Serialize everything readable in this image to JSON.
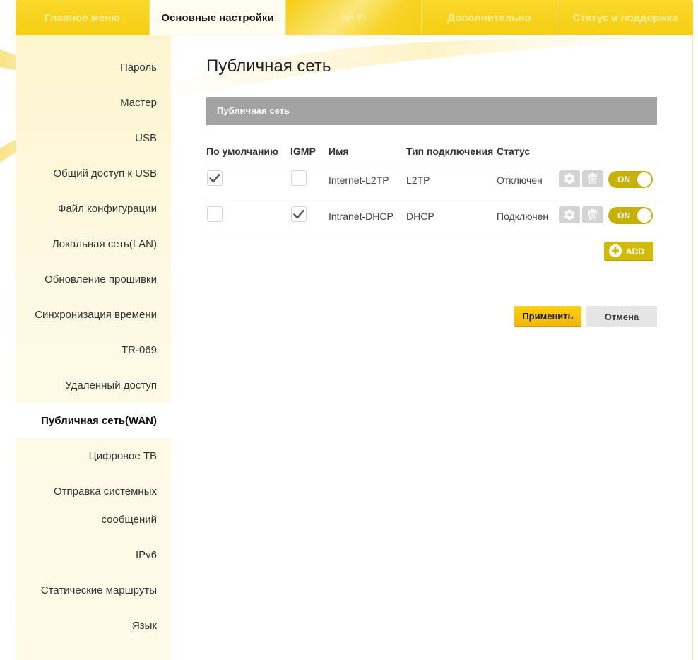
{
  "topnav": {
    "tabs": [
      {
        "label": "Главное меню",
        "active": false
      },
      {
        "label": "Основные настройки",
        "active": true
      },
      {
        "label": "Wi-Fi",
        "active": false
      },
      {
        "label": "Дополнительно",
        "active": false
      },
      {
        "label": "Статус и поддержка",
        "active": false
      }
    ]
  },
  "sidebar": {
    "items": [
      {
        "label": "Пароль"
      },
      {
        "label": "Мастер"
      },
      {
        "label": "USB"
      },
      {
        "label": "Общий доступ к USB"
      },
      {
        "label": "Файл конфигурации"
      },
      {
        "label": "Локальная сеть(LAN)"
      },
      {
        "label": "Обновление прошивки"
      },
      {
        "label": "Синхронизация времени"
      },
      {
        "label": "TR-069"
      },
      {
        "label": "Удаленный доступ"
      },
      {
        "label": "Публичная сеть(WAN)",
        "active": true
      },
      {
        "label": "Цифровое ТВ"
      },
      {
        "label": "Отправка системных"
      },
      {
        "label": "сообщений"
      },
      {
        "label": "IPv6"
      },
      {
        "label": "Статические маршруты"
      },
      {
        "label": "Язык"
      }
    ]
  },
  "main": {
    "title": "Публичная сеть",
    "section_title": "Публичная сеть",
    "table": {
      "headers": [
        "По умолчанию",
        "IGMP",
        "Имя",
        "Тип подключения",
        "Статус"
      ],
      "rows": [
        {
          "default": true,
          "igmp": false,
          "name": "Internet-L2TP",
          "type": "L2TP",
          "status": "Отключен",
          "toggle": "ON"
        },
        {
          "default": false,
          "igmp": true,
          "name": "Intranet-DHCP",
          "type": "DHCP",
          "status": "Подключен",
          "toggle": "ON"
        }
      ]
    },
    "add_label": "ADD",
    "apply_label": "Применить",
    "cancel_label": "Отмена"
  },
  "colors": {
    "brand_yellow": "#f7d21a",
    "toggle_on": "#c7b107",
    "apply_button": "#fcd116",
    "section_bar": "#a3a3a3"
  },
  "icons": {
    "settings": "gear-icon",
    "delete": "trash-icon",
    "add": "plus-circle-icon",
    "checked": "checkmark-icon"
  }
}
